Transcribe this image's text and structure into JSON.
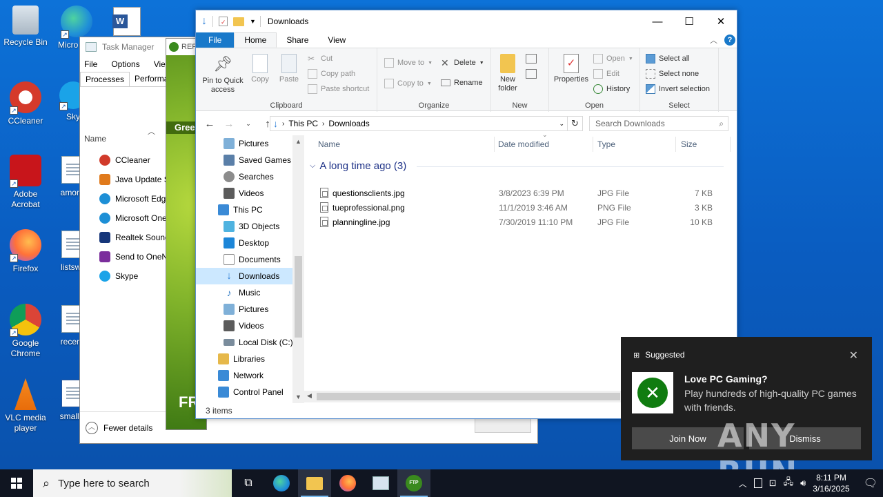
{
  "desktop": {
    "icons": [
      {
        "label": "Recycle Bin"
      },
      {
        "label": "Micro Edg"
      },
      {
        "label": "CCleaner"
      },
      {
        "label": "Sky"
      },
      {
        "label": "Adobe Acrobat"
      },
      {
        "label": "among"
      },
      {
        "label": "Firefox"
      },
      {
        "label": "listswo"
      },
      {
        "label": "Google Chrome"
      },
      {
        "label": "recentf"
      },
      {
        "label": "VLC media player"
      },
      {
        "label": "smaller"
      }
    ]
  },
  "task_manager": {
    "title": "Task Manager",
    "menu": [
      "File",
      "Options",
      "View"
    ],
    "tabs": [
      "Processes",
      "Performan"
    ],
    "column_name": "Name",
    "apps": [
      {
        "name": "CCleaner",
        "color": "#d13a2a"
      },
      {
        "name": "Java Update Sc",
        "color": "#e07a1c"
      },
      {
        "name": "Microsoft Edg",
        "color": "#1d8fd6"
      },
      {
        "name": "Microsoft One",
        "color": "#1d8fd6"
      },
      {
        "name": "Realtek Sound",
        "color": "#16367a"
      },
      {
        "name": "Send to OneN",
        "color": "#7b2e9c"
      },
      {
        "name": "Skype",
        "color": "#1aa3e8"
      }
    ],
    "fewer_details": "Fewer details"
  },
  "refs_window": {
    "title": "REF",
    "strip": "Gree",
    "logo": "FR"
  },
  "explorer": {
    "title": "Downloads",
    "tabs": {
      "file": "File",
      "home": "Home",
      "share": "Share",
      "view": "View"
    },
    "ribbon": {
      "clipboard": {
        "label": "Clipboard",
        "pin": "Pin to Quick access",
        "copy": "Copy",
        "paste": "Paste",
        "cut": "Cut",
        "copy_path": "Copy path",
        "paste_shortcut": "Paste shortcut"
      },
      "organize": {
        "label": "Organize",
        "move_to": "Move to",
        "copy_to": "Copy to",
        "delete": "Delete",
        "rename": "Rename"
      },
      "new": {
        "label": "New",
        "new_folder": "New folder"
      },
      "open": {
        "label": "Open",
        "properties": "Properties",
        "open": "Open",
        "edit": "Edit",
        "history": "History"
      },
      "select": {
        "label": "Select",
        "select_all": "Select all",
        "select_none": "Select none",
        "invert": "Invert selection"
      }
    },
    "address": {
      "crumbs": [
        "This PC",
        "Downloads"
      ],
      "search_placeholder": "Search Downloads"
    },
    "nav_pane": [
      {
        "label": "Pictures",
        "color": "#7fb0d8",
        "indent": 40
      },
      {
        "label": "Saved Games",
        "color": "#5a7fa8",
        "indent": 40
      },
      {
        "label": "Searches",
        "color": "#8c8c8c",
        "indent": 40
      },
      {
        "label": "Videos",
        "color": "#5b5b5b",
        "indent": 40
      },
      {
        "label": "This PC",
        "color": "#3a8ad6",
        "indent": 32
      },
      {
        "label": "3D Objects",
        "color": "#4fb3e0",
        "indent": 40
      },
      {
        "label": "Desktop",
        "color": "#1c86d8",
        "indent": 40
      },
      {
        "label": "Documents",
        "color": "#8c8c8c",
        "indent": 40
      },
      {
        "label": "Downloads",
        "color": "#2a7dd6",
        "indent": 40
      },
      {
        "label": "Music",
        "color": "#2f7bc4",
        "indent": 40
      },
      {
        "label": "Pictures",
        "color": "#7fb0d8",
        "indent": 40
      },
      {
        "label": "Videos",
        "color": "#5b5b5b",
        "indent": 40
      },
      {
        "label": "Local Disk (C:)",
        "color": "#7a8c9c",
        "indent": 40
      },
      {
        "label": "Libraries",
        "color": "#e6b84a",
        "indent": 32
      },
      {
        "label": "Network",
        "color": "#3a8ad6",
        "indent": 32
      },
      {
        "label": "Control Panel",
        "color": "#3a8ad6",
        "indent": 32
      }
    ],
    "selected_nav": "Downloads",
    "columns": {
      "name": "Name",
      "date": "Date modified",
      "type": "Type",
      "size": "Size"
    },
    "group_header": "A long time ago (3)",
    "files": [
      {
        "name": "questionsclients.jpg",
        "date": "3/8/2023 6:39 PM",
        "type": "JPG File",
        "size": "7 KB"
      },
      {
        "name": "tueprofessional.png",
        "date": "11/1/2019 3:46 AM",
        "type": "PNG File",
        "size": "3 KB"
      },
      {
        "name": "planningline.jpg",
        "date": "7/30/2019 11:10 PM",
        "type": "JPG File",
        "size": "10 KB"
      }
    ],
    "status": "3 items"
  },
  "toast": {
    "header": "Suggested",
    "title": "Love PC Gaming?",
    "body": "Play hundreds of high-quality PC games with friends.",
    "join": "Join Now",
    "dismiss": "Dismiss"
  },
  "watermark": "ANY RUN",
  "taskbar": {
    "search_placeholder": "Type here to search",
    "time": "8:11 PM",
    "date": "3/16/2025"
  }
}
